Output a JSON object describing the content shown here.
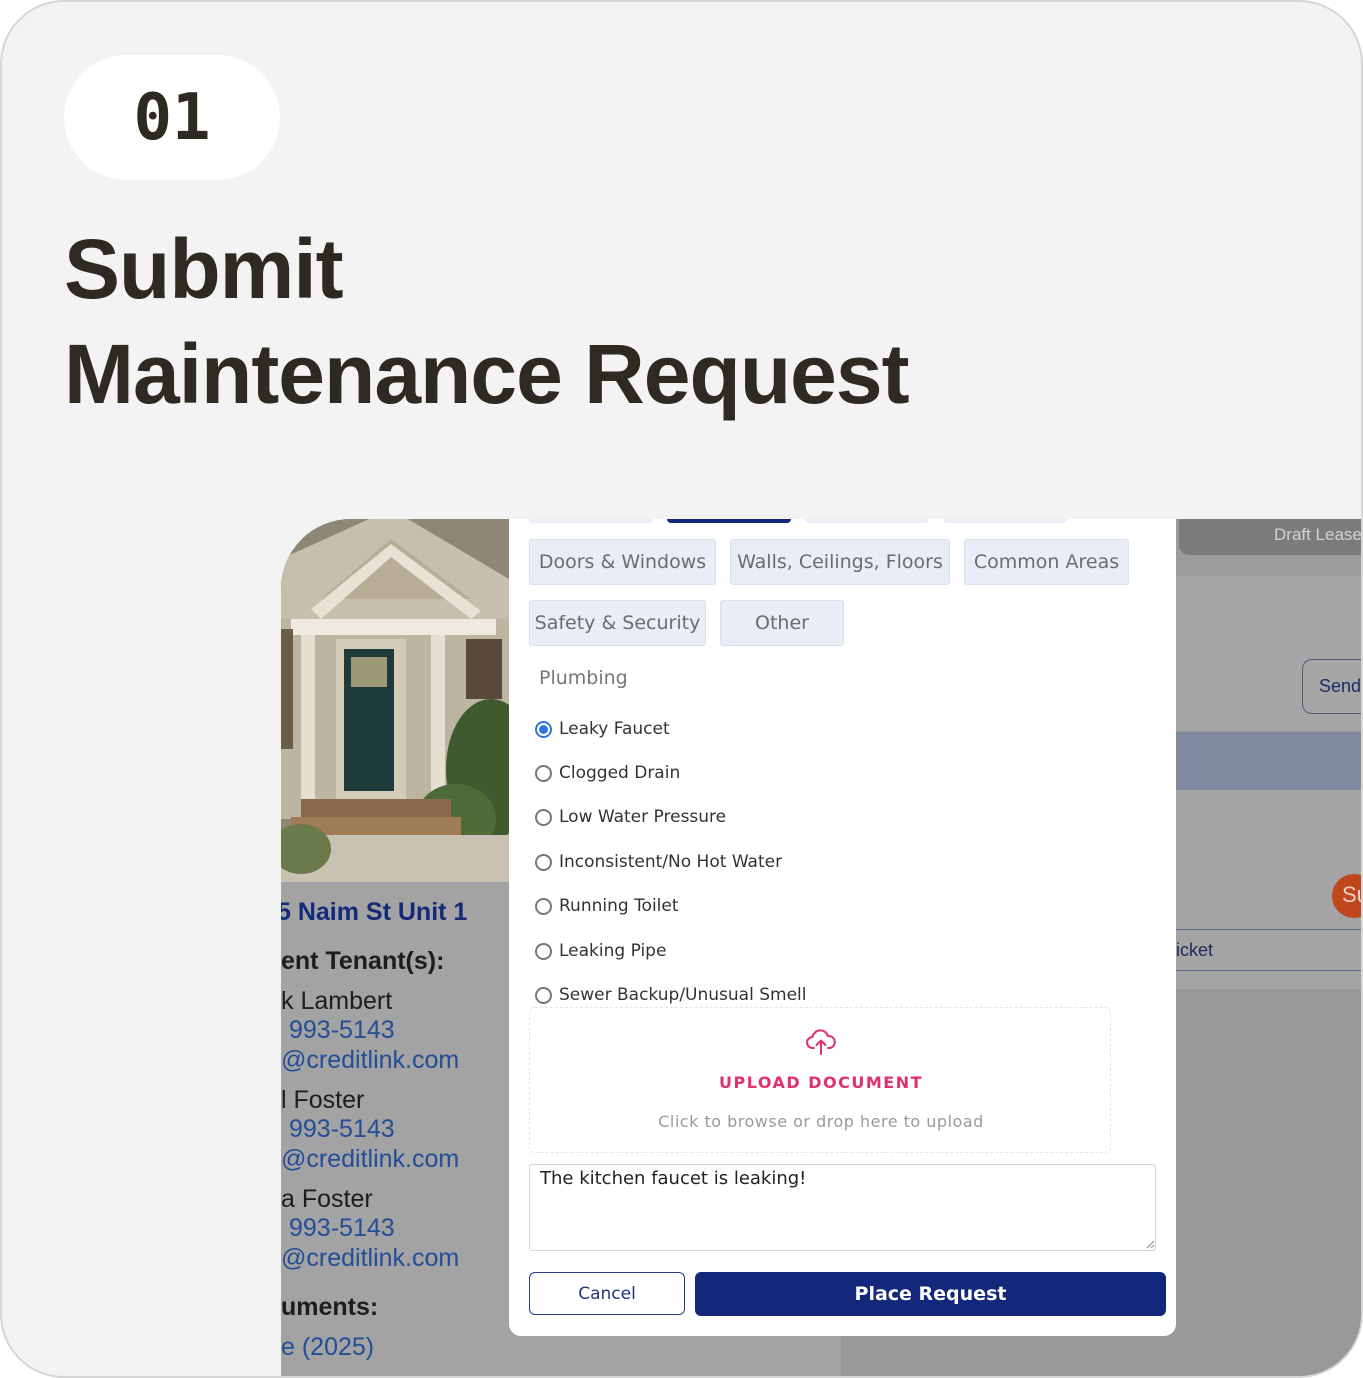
{
  "step_number": "01",
  "headline": {
    "line1": "Submit",
    "line2": "Maintenance Request"
  },
  "background_page": {
    "property_address": "5 Naim St Unit 1",
    "tenants_heading": "ent Tenant(s):",
    "tenants": [
      {
        "name": "k Lambert",
        "phone": "993-5143",
        "email": "@creditlink.com"
      },
      {
        "name": "l Foster",
        "phone": "993-5143",
        "email": "@creditlink.com"
      },
      {
        "name": "a Foster",
        "phone": "993-5143",
        "email": "@creditlink.com"
      }
    ],
    "documents_heading": "uments:",
    "document_link": "e (2025)",
    "draft_lease_tab": "Draft Lease",
    "send_button": "Send",
    "status_badge": "Su",
    "ticket_label": "icket"
  },
  "modal": {
    "categories_row1": [
      "Doors & Windows",
      "Walls, Ceilings, Floors",
      "Common Areas"
    ],
    "categories_row2": [
      "Safety & Security",
      "Other"
    ],
    "group_title": "Plumbing",
    "options": [
      "Leaky Faucet",
      "Clogged Drain",
      "Low Water Pressure",
      "Inconsistent/No Hot Water",
      "Running Toilet",
      "Leaking Pipe",
      "Sewer Backup/Unusual Smell"
    ],
    "selected_option": "Leaky Faucet",
    "upload": {
      "icon": "cloud-upload-icon",
      "title": "UPLOAD DOCUMENT",
      "subtitle": "Click to browse or drop here to upload"
    },
    "description_value": "The kitchen faucet is leaking!",
    "cancel_label": "Cancel",
    "submit_label": "Place Request"
  },
  "colors": {
    "primary": "#13287a",
    "radio_selected": "#2f77e0",
    "upload_accent": "#e0306e",
    "category_bg": "#e9edf6"
  }
}
